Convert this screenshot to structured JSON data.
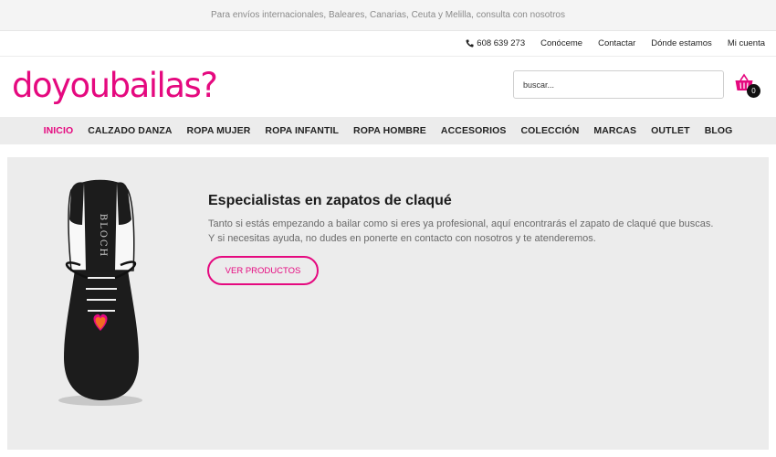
{
  "announcement": "Para envíos internacionales, Baleares, Canarias, Ceuta y Melilla, consulta con nosotros",
  "utility_links": {
    "phone": "608 639 273",
    "about": "Conóceme",
    "contact": "Contactar",
    "stores": "Dónde estamos",
    "account": "Mi cuenta"
  },
  "logo": "doyoubailas?",
  "search": {
    "placeholder": "buscar..."
  },
  "cart": {
    "count": "0",
    "icon": "basket-icon"
  },
  "nav": [
    {
      "label": "INICIO",
      "active": true
    },
    {
      "label": "CALZADO DANZA"
    },
    {
      "label": "ROPA MUJER"
    },
    {
      "label": "ROPA INFANTIL"
    },
    {
      "label": "ROPA HOMBRE"
    },
    {
      "label": "ACCESORIOS"
    },
    {
      "label": "COLECCIÓN"
    },
    {
      "label": "MARCAS"
    },
    {
      "label": "OUTLET"
    },
    {
      "label": "BLOG"
    }
  ],
  "hero": {
    "title": "Especialistas en zapatos de claqué",
    "line1": "Tanto si estás empezando a bailar como si eres ya profesional, aquí encontrarás el zapato de claqué que buscas.",
    "line2": "Y si necesitas ayuda, no dudes en ponerte en contacto con nosotros y te atenderemos.",
    "button": "VER PRODUCTOS",
    "image_brand": "BLOCH"
  },
  "colors": {
    "accent": "#e5097f",
    "nav_bg": "#ececec",
    "hero_bg": "#ececec"
  }
}
